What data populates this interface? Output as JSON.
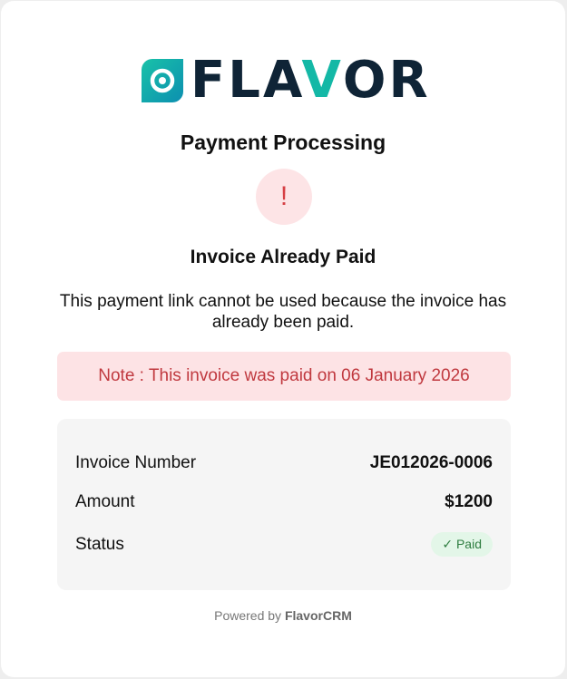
{
  "brand": {
    "logo_text_start": "FLA",
    "logo_text_accent": "V",
    "logo_text_end": "OR"
  },
  "page": {
    "title": "Payment Processing",
    "alert_icon": "!",
    "heading": "Invoice Already Paid",
    "message": "This payment link cannot be used because the invoice has already been paid.",
    "note": "Note : This invoice was paid on 06 January 2026"
  },
  "invoice": {
    "number_label": "Invoice Number",
    "number_value": "JE012026-0006",
    "amount_label": "Amount",
    "amount_value": "$1200",
    "status_label": "Status",
    "status_check": "✓",
    "status_value": "Paid"
  },
  "footer": {
    "powered_by": "Powered by",
    "brand": "FlavorCRM"
  },
  "colors": {
    "brand_dark": "#0f2436",
    "brand_teal": "#14b8a6",
    "error_red": "#c0393f",
    "success_green": "#2e7d40"
  },
  "icons": {
    "logo": "flavor-logo-icon",
    "alert": "exclamation-icon",
    "check": "check-icon"
  }
}
